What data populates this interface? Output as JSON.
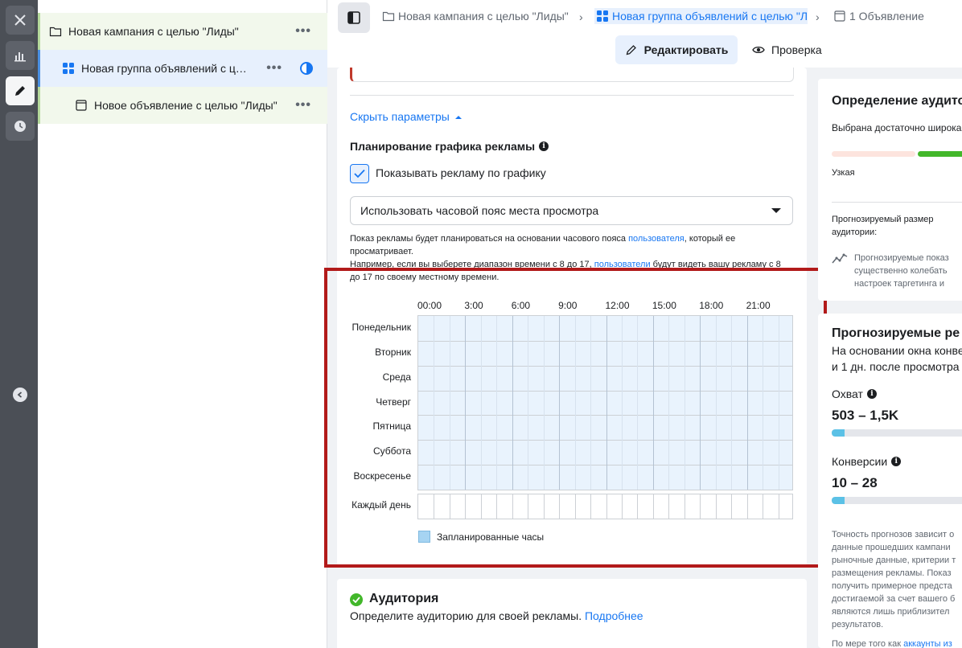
{
  "tree": {
    "campaign": "Новая кампания с целью \"Лиды\"",
    "adset": "Новая группа объявлений с целью \"Лиды\"",
    "ad": "Новое объявление с целью \"Лиды\"",
    "more": "•••"
  },
  "breadcrumb": {
    "campaign": "Новая кампания с целью \"Лиды\"",
    "adset": "Новая группа объявлений с целью \"Л",
    "ad": "1 Объявление"
  },
  "actions": {
    "edit": "Редактировать",
    "review": "Проверка"
  },
  "schedule": {
    "hide_params": "Скрыть параметры",
    "title": "Планирование графика рекламы",
    "checkbox_label": "Показывать рекламу по графику",
    "checkbox_checked": true,
    "timezone_selected": "Использовать часовой пояс места просмотра",
    "help_part1": "Показ рекламы будет планироваться на основании часового пояса ",
    "help_link1": "пользователя",
    "help_part2": ", который ее просматривает.",
    "help_part3": "Например, если вы выберете диапазон времени с 8 до 17, ",
    "help_link2": "пользователи",
    "help_part4": " будут видеть вашу рекламу с 8 до 17 по своему местному времени.",
    "hours": [
      "00:00",
      "3:00",
      "6:00",
      "9:00",
      "12:00",
      "15:00",
      "18:00",
      "21:00"
    ],
    "days": [
      "Понедельник",
      "Вторник",
      "Среда",
      "Четверг",
      "Пятница",
      "Суббота",
      "Воскресенье"
    ],
    "every_day": "Каждый день",
    "legend": "Запланированные часы"
  },
  "audience": {
    "title": "Аудитория",
    "desc": "Определите аудиторию для своей рекламы. ",
    "link": "Подробнее"
  },
  "right": {
    "def_title": "Определение аудито",
    "def_text": "Выбрана достаточно широка",
    "narrow": "Узкая",
    "size_label_1": "Прогнозируемый размер",
    "size_label_2": "аудитории:",
    "size_note_1": "Прогнозируемые показ",
    "size_note_2": "существенно колебать",
    "size_note_3": "настроек таргетинга и",
    "est_title": "Прогнозируемые ре",
    "est_sub_1": "На основании окна конве",
    "est_sub_2": "и 1 дн. после просмотра",
    "reach_label": "Охват",
    "reach_value": "503 – 1,5K",
    "conv_label": "Конверсии",
    "conv_value": "10 – 28",
    "acc_1": "Точность прогнозов зависит о",
    "acc_2": "данные прошедших кампани",
    "acc_3": "рыночные данные, критерии т",
    "acc_4": "размещения рекламы. Показ",
    "acc_5": "получить примерное предста",
    "acc_6": "достигаемой за счет вашего б",
    "acc_7": "являются лишь приблизител",
    "acc_8": "результатов.",
    "acc_9": "По мере того как ",
    "acc_link": "аккаунты из"
  }
}
